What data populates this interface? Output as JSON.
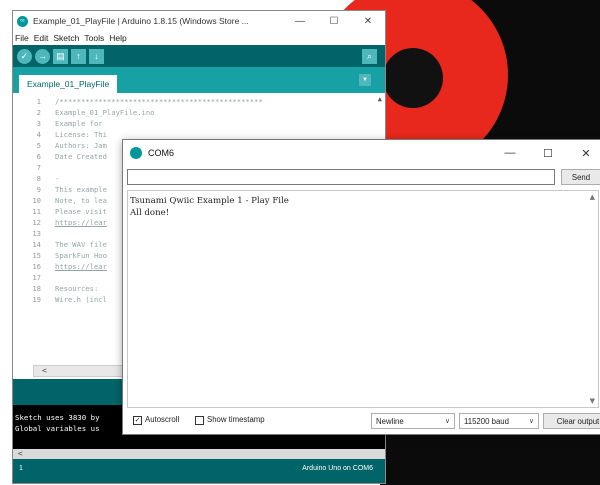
{
  "arduino": {
    "title": "Example_01_PlayFile | Arduino 1.8.15 (Windows Store ...",
    "win_min": "—",
    "win_max": "☐",
    "win_close": "✕",
    "menu": [
      "File",
      "Edit",
      "Sketch",
      "Tools",
      "Help"
    ],
    "tab": "Example_01_PlayFile",
    "tab_menu_glyph": "▼",
    "code_lines": [
      {
        "n": "1",
        "t": "/***********************************************"
      },
      {
        "n": "2",
        "t": "Example_01_PlayFile.ino"
      },
      {
        "n": "3",
        "t": "Example for"
      },
      {
        "n": "4",
        "t": "License: Thi"
      },
      {
        "n": "5",
        "t": "Authors: Jam"
      },
      {
        "n": "6",
        "t": "Date Created"
      },
      {
        "n": "7",
        "t": ""
      },
      {
        "n": "8",
        "t": "-"
      },
      {
        "n": "9",
        "t": "This example"
      },
      {
        "n": "10",
        "t": "Note, to lea"
      },
      {
        "n": "11",
        "t": "Please visit"
      },
      {
        "n": "12",
        "t": "https://lear"
      },
      {
        "n": "13",
        "t": ""
      },
      {
        "n": "14",
        "t": "The WAV file"
      },
      {
        "n": "15",
        "t": "SparkFun Hoo"
      },
      {
        "n": "16",
        "t": "https://lear"
      },
      {
        "n": "17",
        "t": ""
      },
      {
        "n": "18",
        "t": "Resources:"
      },
      {
        "n": "19",
        "t": "Wire.h (incl"
      }
    ],
    "console_lines": [
      "Sketch uses 3830 by",
      "Global variables us"
    ],
    "footer_line": "1",
    "footer_board": "Arduino Uno on COM6"
  },
  "serial": {
    "title": "COM6",
    "min": "—",
    "max": "☐",
    "close": "✕",
    "input_value": "",
    "send_label": "Send",
    "output_lines": [
      "Tsunami Qwiic Example 1 - Play File",
      "All done!"
    ],
    "autoscroll_label": "Autoscroll",
    "autoscroll_checked": true,
    "timestamp_label": "Show timestamp",
    "timestamp_checked": false,
    "line_ending": "Newline",
    "baud": "115200 baud",
    "clear_label": "Clear output"
  },
  "colors": {
    "teal_dark": "#006468",
    "teal_mid": "#17a1a5",
    "teal_light": "#4db7bb",
    "red": "#e8281c"
  }
}
